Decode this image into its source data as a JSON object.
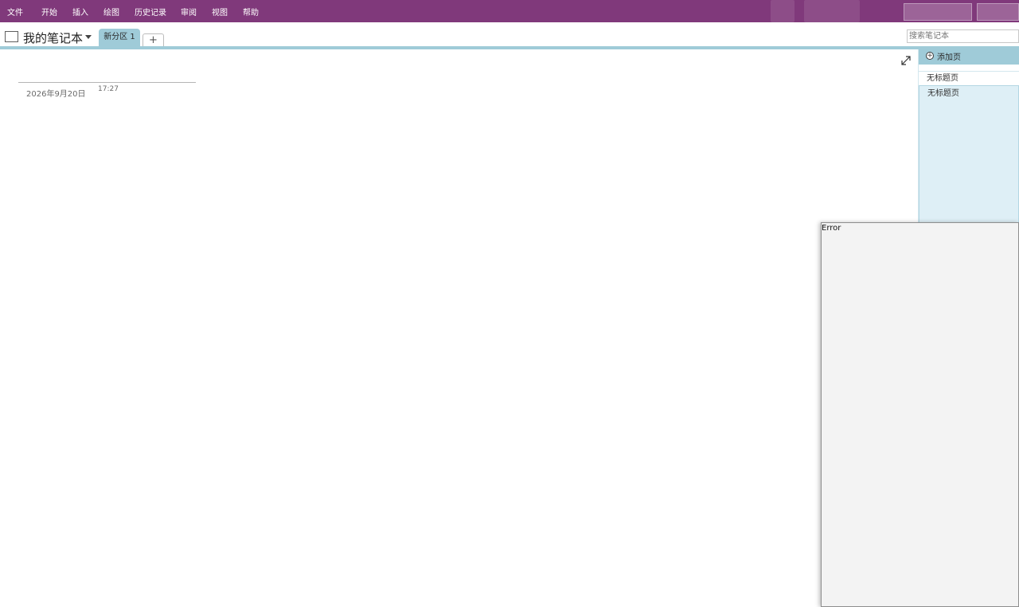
{
  "menubar": {
    "items": [
      "文件",
      "开始",
      "插入",
      "绘图",
      "历史记录",
      "审阅",
      "视图",
      "帮助"
    ]
  },
  "notebook": {
    "name": "我的笔记本",
    "section_tab": "新分区 1",
    "add_tab_label": "+",
    "search_placeholder": "搜索笔记本"
  },
  "page": {
    "date": "2026年9月20日",
    "time": "17:27"
  },
  "pages_panel": {
    "add_page_label": "添加页",
    "pages": [
      "无标题页",
      "无标题页"
    ]
  },
  "error_window": {
    "title": "Error"
  },
  "colors": {
    "ribbon": "#80397b",
    "section_accent": "#9fcbd8",
    "selected_page": "#deeff6"
  },
  "icons": [
    "notebook-icon",
    "chevron-down-icon",
    "plus-icon",
    "expand-icon",
    "add-page-icon"
  ]
}
